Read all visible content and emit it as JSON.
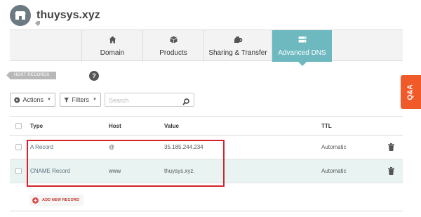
{
  "domain": {
    "name": "thuysys.xyz"
  },
  "tabs": [
    {
      "label": "Domain",
      "icon": "home-icon",
      "active": false
    },
    {
      "label": "Products",
      "icon": "box-icon",
      "active": false
    },
    {
      "label": "Sharing & Transfer",
      "icon": "share-icon",
      "active": false
    },
    {
      "label": "Advanced DNS",
      "icon": "dns-icon",
      "active": true
    }
  ],
  "section": {
    "tag": "HOST RECORDS",
    "help": "?"
  },
  "toolbar": {
    "actions_label": "Actions",
    "filters_label": "Filters",
    "search_placeholder": "Search"
  },
  "table": {
    "columns": [
      "Type",
      "Host",
      "Value",
      "TTL"
    ],
    "rows": [
      {
        "type": "A Record",
        "host": "@",
        "value": "35.185.244.234",
        "ttl": "Automatic"
      },
      {
        "type": "CNAME Record",
        "host": "www",
        "value": "thuysys.xyz.",
        "ttl": "Automatic"
      }
    ]
  },
  "add_record_label": "ADD NEW RECORD",
  "qa_label": "Q&A",
  "colors": {
    "accent": "#6eb8c0",
    "highlight_border": "#d3242b",
    "qa_tab": "#f05a28",
    "add_icon": "#d9534f"
  }
}
